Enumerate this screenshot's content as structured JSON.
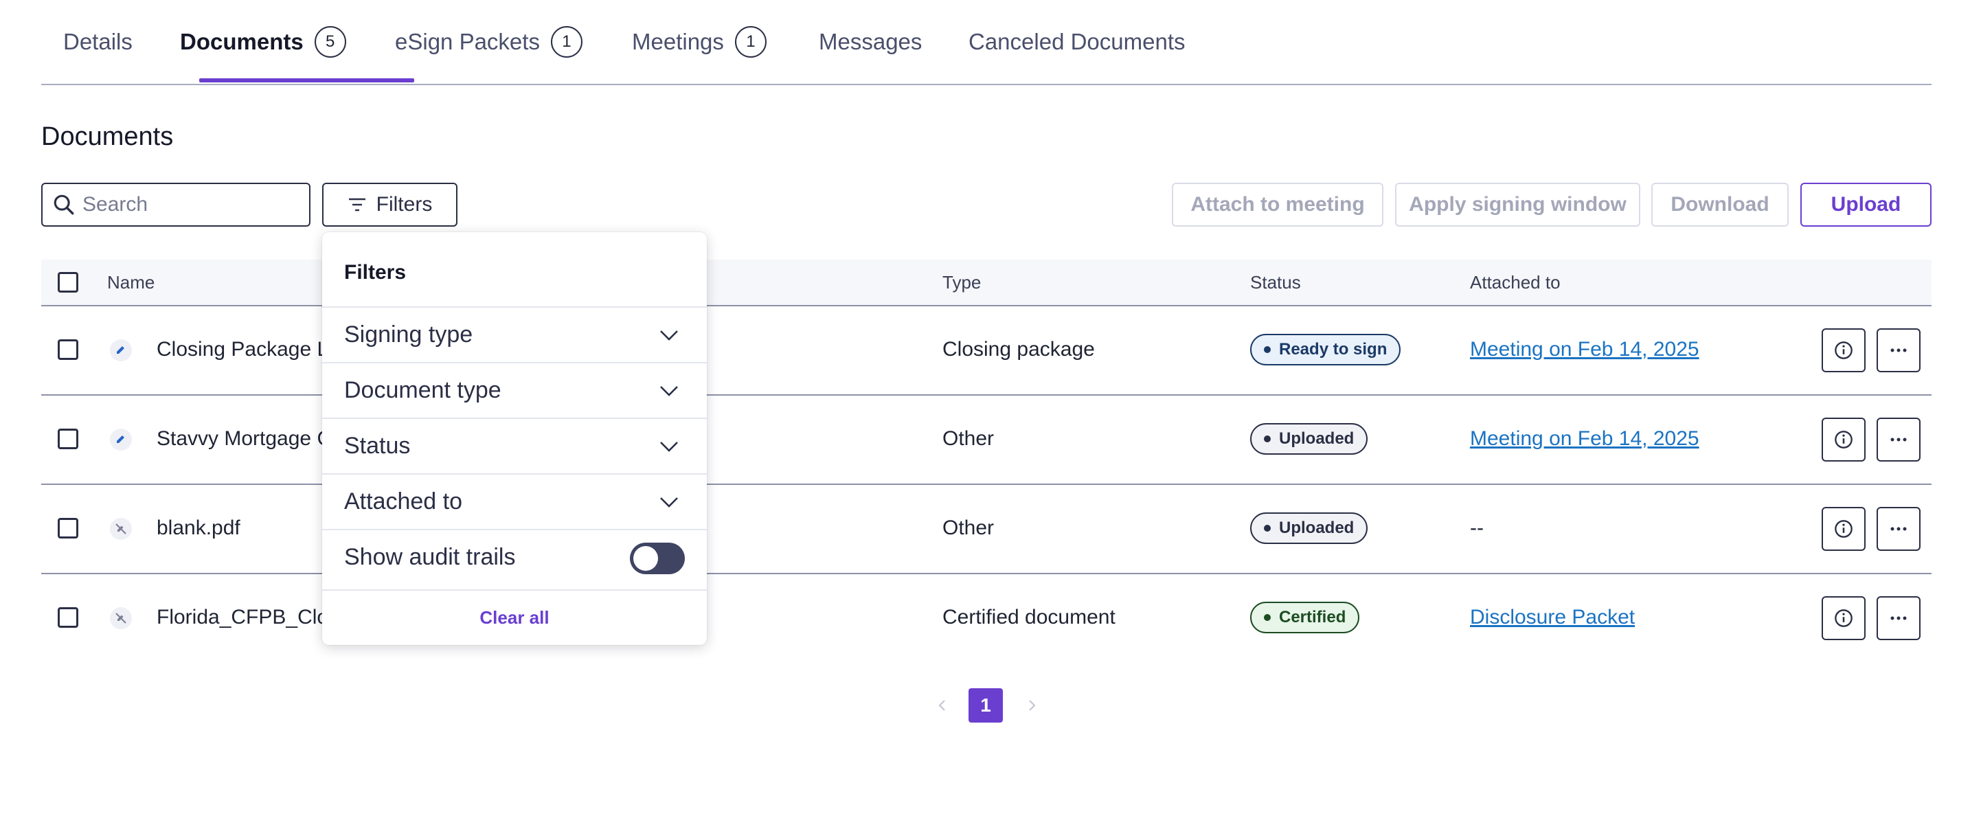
{
  "tabs": [
    {
      "label": "Details",
      "count": null
    },
    {
      "label": "Documents",
      "count": "5"
    },
    {
      "label": "eSign Packets",
      "count": "1"
    },
    {
      "label": "Meetings",
      "count": "1"
    },
    {
      "label": "Messages",
      "count": null
    },
    {
      "label": "Canceled Documents",
      "count": null
    }
  ],
  "section_title": "Documents",
  "search": {
    "placeholder": "Search",
    "value": ""
  },
  "filters_button": "Filters",
  "actions": {
    "attach": "Attach to meeting",
    "apply_window": "Apply signing window",
    "download": "Download",
    "upload": "Upload"
  },
  "table": {
    "headers": {
      "name": "Name",
      "type": "Type",
      "status": "Status",
      "attached": "Attached to"
    },
    "rows": [
      {
        "name": "Closing Package L",
        "icon": "pencil-icon",
        "type": "Closing package",
        "status": "Ready to sign",
        "attached": "Meeting on Feb 14, 2025"
      },
      {
        "name": "Stavvy Mortgage C",
        "icon": "pencil-icon",
        "type": "Other",
        "status": "Uploaded",
        "attached": "Meeting on Feb 14, 2025"
      },
      {
        "name": "blank.pdf",
        "icon": "no-sign-icon",
        "type": "Other",
        "status": "Uploaded",
        "attached": "--"
      },
      {
        "name": "Florida_CFPB_Clo",
        "icon": "no-sign-icon",
        "type": "Certified document",
        "status": "Certified",
        "attached": "Disclosure Packet"
      }
    ]
  },
  "pagination": {
    "current": "1"
  },
  "filter_panel": {
    "title": "Filters",
    "options": [
      "Signing type",
      "Document type",
      "Status",
      "Attached to"
    ],
    "audit_label": "Show audit trails",
    "audit_enabled": false,
    "clear": "Clear all"
  },
  "colors": {
    "accent": "#6a3fd0",
    "link": "#1b73c2",
    "ready_bg": "#e9f1fb",
    "certified_bg": "#e8f5e9"
  }
}
